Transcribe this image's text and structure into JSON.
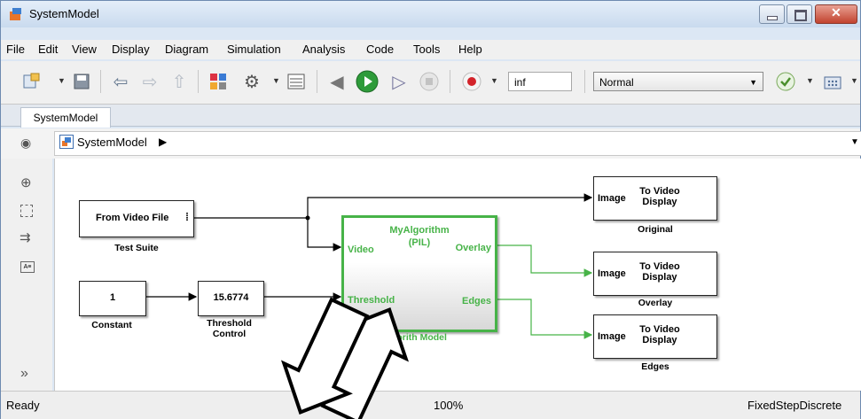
{
  "window": {
    "title": "SystemModel"
  },
  "menu": [
    "File",
    "Edit",
    "View",
    "Display",
    "Diagram",
    "Simulation",
    "Analysis",
    "Code",
    "Tools",
    "Help"
  ],
  "toolbar": {
    "stop_time": "inf",
    "sim_mode": "Normal"
  },
  "tabs": [
    {
      "label": "SystemModel"
    }
  ],
  "address": {
    "path": "SystemModel"
  },
  "blocks": {
    "from_video": {
      "text": "From Video File",
      "label": "Test Suite"
    },
    "constant": {
      "value": "1",
      "label": "Constant"
    },
    "threshold": {
      "value": "15.6774",
      "label": "Threshold\nControl"
    },
    "algorithm": {
      "title": "MyAlgorithm",
      "mode": "(PIL)",
      "in1": "Video",
      "in2": "Threshold",
      "out1": "Overlay",
      "out2": "Edges",
      "label": "lgorith Model"
    },
    "display_original": {
      "port": "Image",
      "text": "To Video\nDisplay",
      "label": "Original"
    },
    "display_overlay": {
      "port": "Image",
      "text": "To Video\nDisplay",
      "label": "Overlay"
    },
    "display_edges": {
      "port": "Image",
      "text": "To Video\nDisplay",
      "label": "Edges"
    }
  },
  "status": {
    "left": "Ready",
    "zoom": "100%",
    "solver": "FixedStepDiscrete"
  },
  "colors": {
    "accent": "#47b348",
    "titlebar": "#c9daee"
  }
}
